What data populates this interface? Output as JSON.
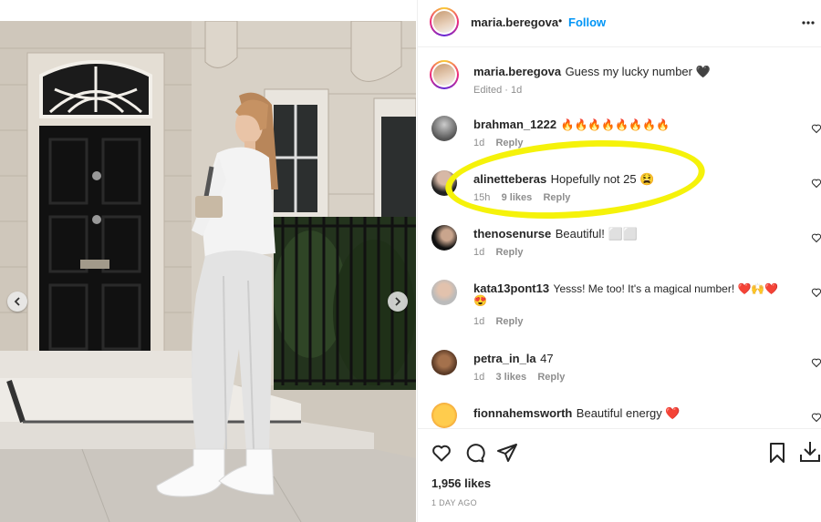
{
  "post": {
    "author": "maria.beregova",
    "dot": "•",
    "follow_label": "Follow",
    "more_icon": "more-horizontal-icon"
  },
  "caption": {
    "author": "maria.beregova",
    "text": "Guess my lucky number 🖤",
    "meta": "Edited · 1d"
  },
  "comments": [
    {
      "user": "brahman_1222",
      "text": "🔥🔥🔥🔥🔥🔥🔥🔥",
      "time": "1d",
      "likes": "",
      "reply": "Reply"
    },
    {
      "user": "alinetteberas",
      "text": "Hopefully not 25 😫",
      "time": "15h",
      "likes": "9 likes",
      "reply": "Reply"
    },
    {
      "user": "thenosenurse",
      "text": "Beautiful! ⬜⬜",
      "time": "1d",
      "likes": "",
      "reply": "Reply"
    },
    {
      "user": "kata13pont13",
      "text": "Yesss! Me too! It's a magical number! ❤️🙌❤️",
      "text2": "😍",
      "time": "1d",
      "likes": "",
      "reply": "Reply"
    },
    {
      "user": "petra_in_la",
      "text": "47",
      "time": "1d",
      "likes": "3 likes",
      "reply": "Reply"
    },
    {
      "user": "fionnahemsworth",
      "text": "Beautiful energy ❤️"
    }
  ],
  "footer": {
    "likes": "1,956 likes",
    "date": "1 DAY AGO"
  },
  "colors": {
    "accent": "#0095f6",
    "annotation": "#f5f20a",
    "text": "#262626",
    "muted": "#8e8e8e"
  }
}
